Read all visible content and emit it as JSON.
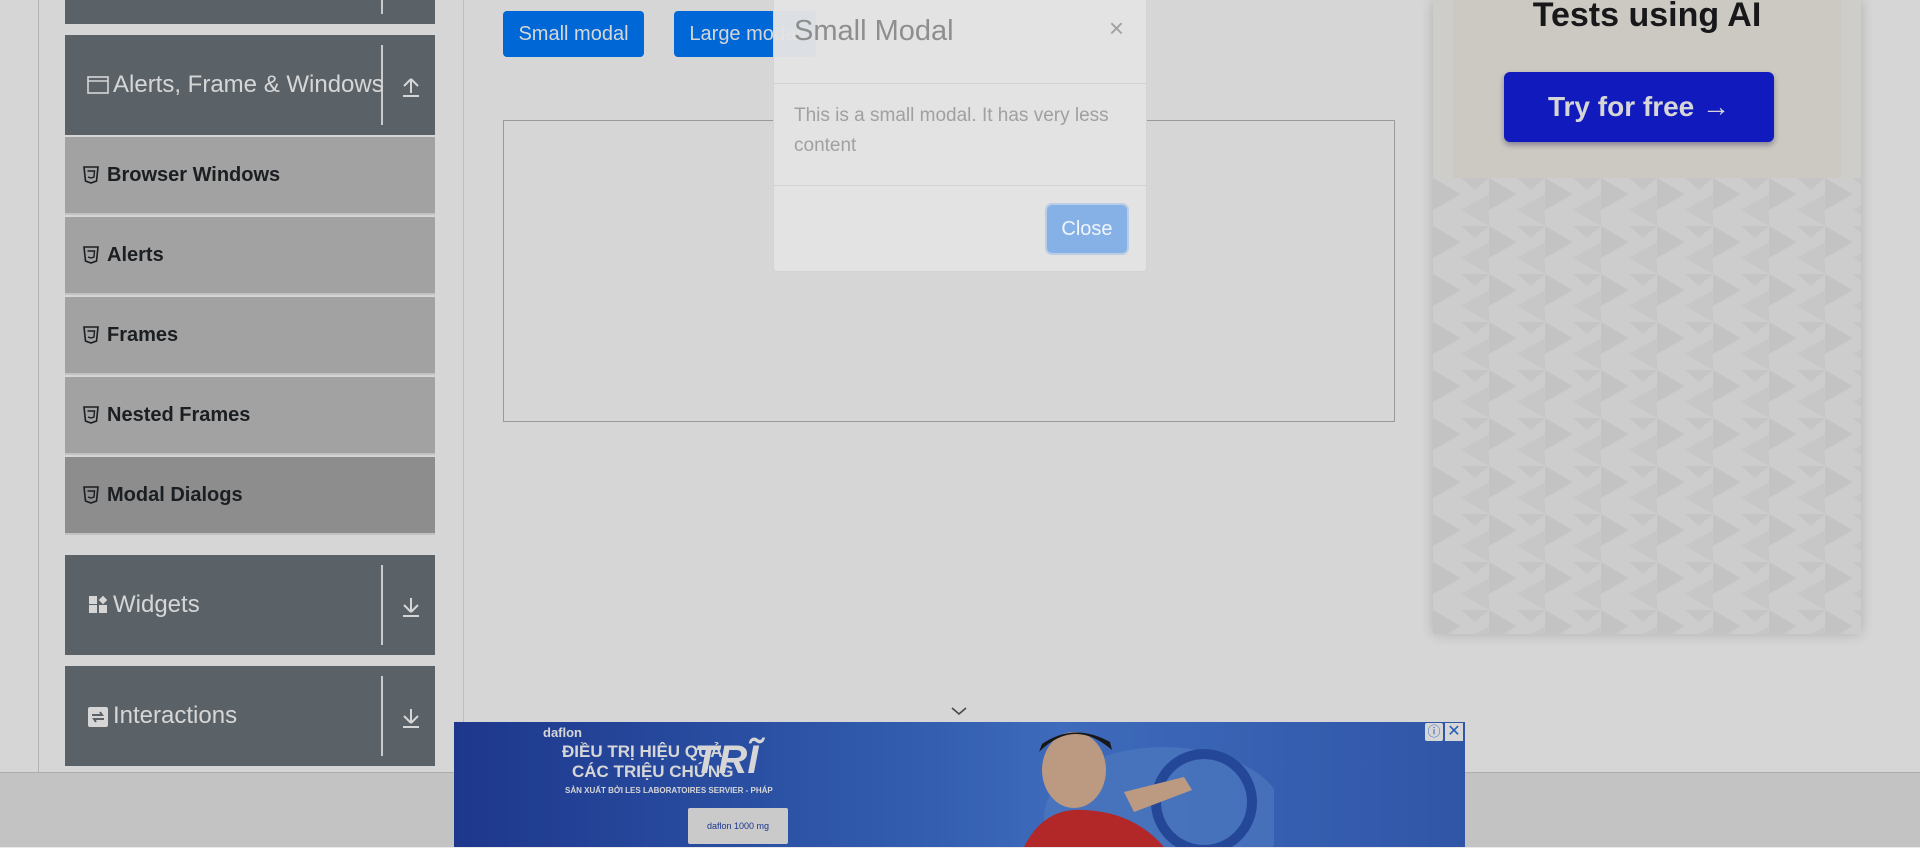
{
  "sidebar": {
    "groups": [
      {
        "label": "Alerts, Frame & Windows",
        "icon": "window-icon",
        "arrow": "arrow-up-icon"
      },
      {
        "label": "Widgets",
        "icon": "widgets-icon",
        "arrow": "arrow-down-icon"
      },
      {
        "label": "Interactions",
        "icon": "interactions-icon",
        "arrow": "arrow-down-icon"
      }
    ],
    "items": [
      {
        "label": "Browser Windows",
        "icon": "html5-icon"
      },
      {
        "label": "Alerts",
        "icon": "html5-icon"
      },
      {
        "label": "Frames",
        "icon": "html5-icon"
      },
      {
        "label": "Nested Frames",
        "icon": "html5-icon"
      },
      {
        "label": "Modal Dialogs",
        "icon": "html5-icon",
        "active": true
      }
    ]
  },
  "main": {
    "small_modal_label": "Small modal",
    "large_modal_label": "Large modal"
  },
  "modal": {
    "title": "Small Modal",
    "close_symbol": "×",
    "body": "This is a small modal. It has very less content",
    "close_button": "Close"
  },
  "ad_right": {
    "title": "Tests using AI",
    "cta": "Try for free →"
  },
  "ad_bottom": {
    "brand": "daflon",
    "headline_1": "ĐIỀU TRỊ HIỆU QUẢ",
    "headline_2": "CÁC TRIỆU CHỨNG",
    "headline_big": "TRĨ",
    "subline": "SẢN XUẤT BỞI LES LABORATOIRES SERVIER - PHÁP",
    "pack_label": "daflon 1000 mg",
    "info_symbol": "ⓘ",
    "close_symbol": "✕"
  },
  "colors": {
    "primary": "#007bff",
    "sidebar_header": "#6c757d",
    "sidebar_item": "#c2c2c2",
    "ad_cta": "#1520e2"
  }
}
